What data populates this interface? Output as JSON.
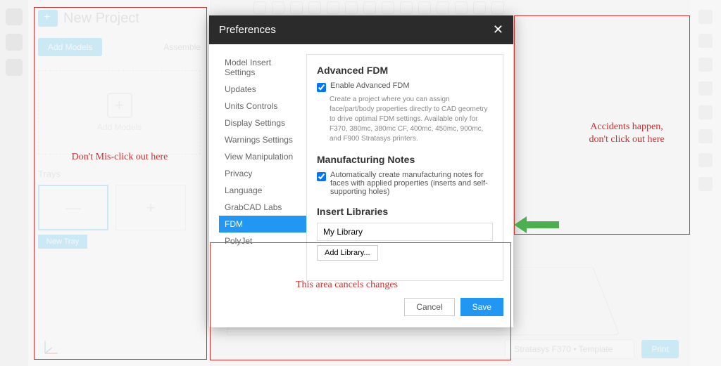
{
  "app": {
    "project_title": "New Project"
  },
  "left_panel": {
    "add_models": "Add Models",
    "assemble": "Assemble",
    "drop_label": "Add Models",
    "trays_label": "Trays",
    "new_tray": "New Tray"
  },
  "printer_bar": {
    "selected": "Stratasys F370 • Template",
    "print": "Print"
  },
  "modal": {
    "title": "Preferences",
    "close": "✕",
    "nav": [
      "Model Insert Settings",
      "Updates",
      "Units Controls",
      "Display Settings",
      "Warnings Settings",
      "View Manipulation",
      "Privacy",
      "Language",
      "GrabCAD Labs",
      "FDM",
      "PolyJet"
    ],
    "active_index": 9,
    "sections": {
      "adv_fdm": {
        "heading": "Advanced FDM",
        "checkbox_label": "Enable Advanced FDM",
        "checked": true,
        "desc": "Create a project where you can assign face/part/body properties directly to CAD geometry to drive optimal FDM settings. Available only for F370, 380mc, 380mc CF, 400mc, 450mc, 900mc, and F900 Stratasys printers."
      },
      "mfg_notes": {
        "heading": "Manufacturing Notes",
        "checkbox_label": "Automatically create manufacturing notes for faces with applied properties (inserts and self-supporting holes)",
        "checked": true
      },
      "insert_lib": {
        "heading": "Insert Libraries",
        "value": "My Library",
        "add_btn": "Add Library..."
      }
    },
    "footer": {
      "cancel": "Cancel",
      "save": "Save"
    }
  },
  "annotations": {
    "left": "Don't Mis-click out here",
    "bottom": "This area cancels changes",
    "right": "Accidents happen, don't click out here"
  }
}
